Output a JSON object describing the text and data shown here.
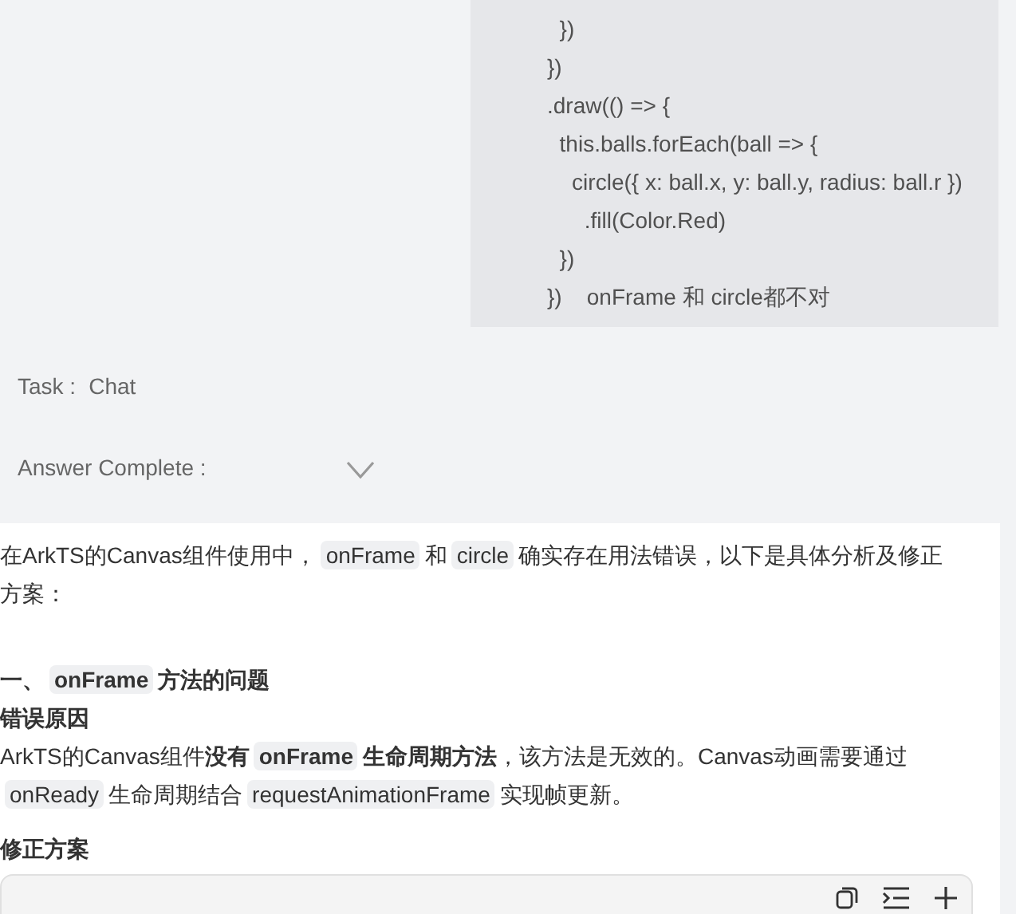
{
  "prompt_code": {
    "lines": [
      "  })",
      "})",
      ".draw(() => {",
      "  this.balls.forEach(ball => {",
      "    circle({ x: ball.x, y: ball.y, radius: ball.r })",
      "      .fill(Color.Red)",
      "  })",
      "})    onFrame 和 circle都不对"
    ]
  },
  "task": {
    "label": "Task :",
    "value": "Chat"
  },
  "answer_status": {
    "label": "Answer Complete :",
    "expanded": false
  },
  "answer": [
    {
      "kind": "paragraph",
      "segments": [
        {
          "text": "在ArkTS的Canvas组件使用中，"
        },
        {
          "text": "onFrame",
          "code": true
        },
        {
          "text": "和"
        },
        {
          "text": "circle",
          "code": true
        },
        {
          "text": "确实存在用法错误，以下是具体分析及修正方案："
        }
      ]
    },
    {
      "kind": "heading",
      "segments": [
        {
          "text": "一、"
        },
        {
          "text": "onFrame",
          "code": true
        },
        {
          "text": "方法的问题"
        }
      ]
    },
    {
      "kind": "subheading",
      "segments": [
        {
          "text": "错误原因"
        }
      ]
    },
    {
      "kind": "paragraph",
      "segments": [
        {
          "text": "ArkTS的Canvas组件"
        },
        {
          "text": "没有",
          "bold": true
        },
        {
          "text": "onFrame",
          "code": true,
          "bold": true
        },
        {
          "text": "生命周期方法",
          "bold": true
        },
        {
          "text": "，该方法是无效的。Canvas动画需要通过"
        },
        {
          "text": "onReady",
          "code": true
        },
        {
          "text": "生命周期结合"
        },
        {
          "text": "requestAnimationFrame",
          "code": true
        },
        {
          "text": "实现帧更新。"
        }
      ]
    },
    {
      "kind": "subheading",
      "segments": [
        {
          "text": "修正方案"
        }
      ]
    },
    {
      "kind": "codeblock"
    }
  ]
}
